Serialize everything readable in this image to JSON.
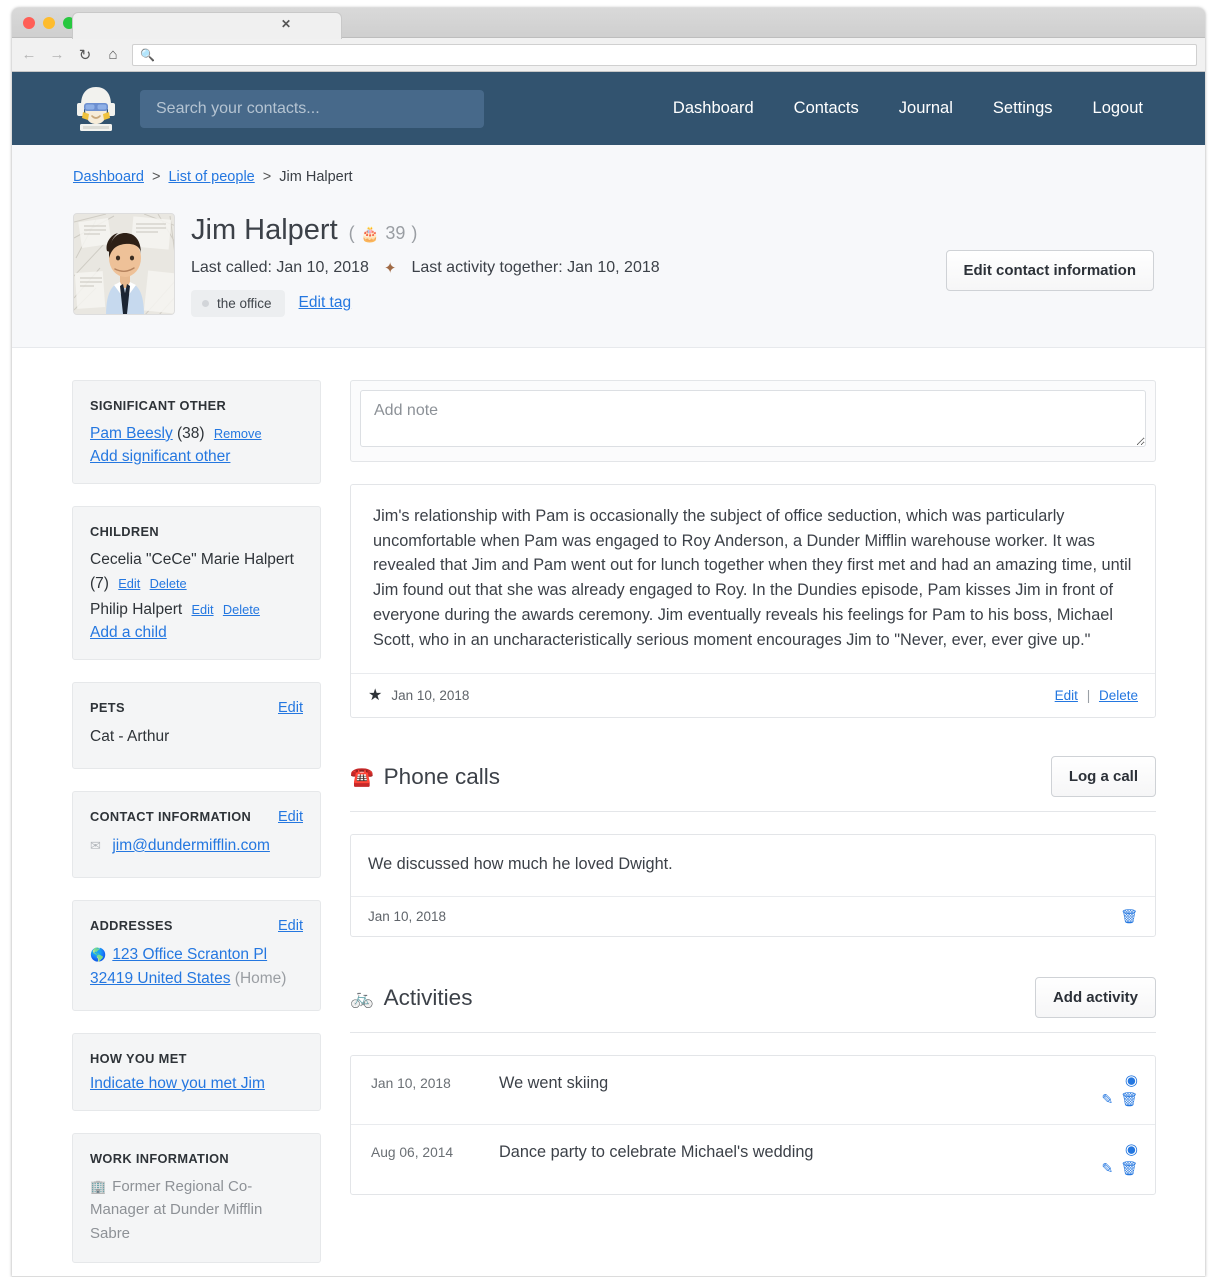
{
  "browser": {
    "tab_close_label": "✕",
    "url_value": "",
    "back_icon": "back-arrow",
    "forward_icon": "forward-arrow",
    "reload_icon": "reload",
    "home_icon": "home",
    "search_icon": "magnifier"
  },
  "navbar": {
    "logo_name": "monica-avatar-logo",
    "search_placeholder": "Search your contacts...",
    "search_value": "",
    "links": [
      {
        "label": "Dashboard"
      },
      {
        "label": "Contacts"
      },
      {
        "label": "Journal"
      },
      {
        "label": "Settings"
      },
      {
        "label": "Logout"
      }
    ]
  },
  "breadcrumb": {
    "items": [
      {
        "label": "Dashboard",
        "link": true
      },
      {
        "label": "List of people",
        "link": true
      },
      {
        "label": "Jim Halpert",
        "link": false
      }
    ],
    "separator": ">"
  },
  "contact": {
    "name": "Jim Halpert",
    "age": "39",
    "cake_icon": "🎂",
    "last_called_label": "Last called: Jan 10, 2018",
    "pulse_icon": "✦",
    "last_activity_label": "Last activity together: Jan 10, 2018",
    "tag": "the office",
    "edit_tag_label": "Edit tag",
    "edit_contact_button": "Edit contact information"
  },
  "sidebar": {
    "significant_other": {
      "title": "SIGNIFICANT OTHER",
      "person_name": "Pam Beesly",
      "person_age": "(38)",
      "remove_label": "Remove",
      "add_label": "Add significant other"
    },
    "children": {
      "title": "CHILDREN",
      "items": [
        {
          "name": "Cecelia \"CeCe\" Marie Halpert (7)",
          "edit": "Edit",
          "delete": "Delete"
        },
        {
          "name": "Philip Halpert",
          "edit": "Edit",
          "delete": "Delete"
        }
      ],
      "add_label": "Add a child"
    },
    "pets": {
      "title": "PETS",
      "edit_label": "Edit",
      "items": [
        "Cat - Arthur"
      ]
    },
    "contact_information": {
      "title": "CONTACT INFORMATION",
      "edit_label": "Edit",
      "email_icon": "envelope-icon",
      "email": "jim@dundermifflin.com"
    },
    "addresses": {
      "title": "ADDRESSES",
      "edit_label": "Edit",
      "globe_icon": "globe-icon",
      "address_line": "123 Office Scranton Pl 32419 United States",
      "address_type": "(Home)"
    },
    "how_you_met": {
      "title": "HOW YOU MET",
      "link_label": "Indicate how you met Jim"
    },
    "work_information": {
      "title": "WORK INFORMATION",
      "building_icon": "building-icon",
      "text": "Former Regional Co-Manager at Dunder Mifflin Sabre"
    }
  },
  "notes": {
    "add_placeholder": "Add note",
    "add_value": "",
    "entries": [
      {
        "body": "Jim's relationship with Pam is occasionally the subject of office seduction, which was particularly uncomfortable when Pam was engaged to Roy Anderson, a Dunder Mifflin warehouse worker. It was revealed that Jim and Pam went out for lunch together when they first met and had an amazing time, until Jim found out that she was already engaged to Roy. In the Dundies episode, Pam kisses Jim in front of everyone during the awards ceremony. Jim eventually reveals his feelings for Pam to his boss, Michael Scott, who in an uncharacteristically serious moment encourages Jim to \"Never, ever, ever give up.\"",
        "date": "Jan 10, 2018",
        "star_icon": "★",
        "edit_label": "Edit",
        "delete_label": "Delete",
        "separator": "|"
      }
    ]
  },
  "phone_calls": {
    "emoji": "☎️",
    "title": "Phone calls",
    "button_label": "Log a call",
    "entries": [
      {
        "body": "We discussed how much he loved Dwight.",
        "date": "Jan 10, 2018",
        "delete_icon": "trash-icon"
      }
    ]
  },
  "activities": {
    "emoji": "🚲",
    "title": "Activities",
    "button_label": "Add activity",
    "entries": [
      {
        "date": "Jan 10, 2018",
        "title": "We went skiing"
      },
      {
        "date": "Aug 06, 2014",
        "title": "Dance party to celebrate Michael's wedding"
      }
    ]
  },
  "colors": {
    "navbar": "#32536f",
    "search_field": "#47698a",
    "link": "#2477e0",
    "band_bg": "#f7f8fa",
    "card_bg": "#f4f5f6",
    "text": "#3c4148"
  }
}
